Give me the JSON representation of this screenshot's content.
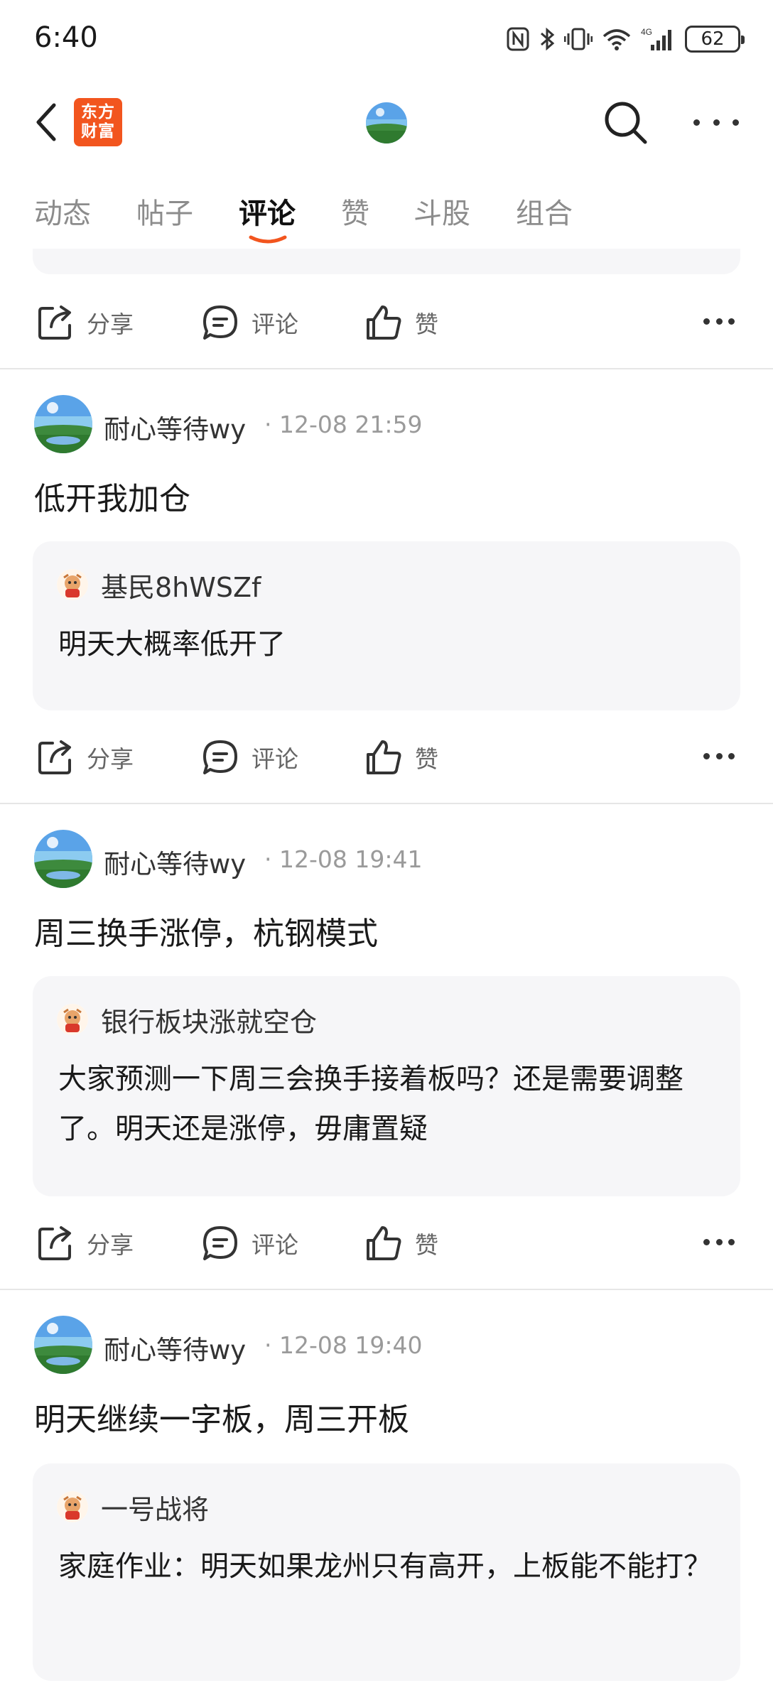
{
  "status_bar": {
    "time": "6:40",
    "battery": "62",
    "network": "4G"
  },
  "nav": {
    "logo_text_line1": "东方",
    "logo_text_line2": "财富",
    "logo_color": "#f2551e"
  },
  "tabs": [
    {
      "label": "动态"
    },
    {
      "label": "帖子"
    },
    {
      "label": "评论",
      "active": true
    },
    {
      "label": "赞"
    },
    {
      "label": "斗股"
    },
    {
      "label": "组合"
    }
  ],
  "actions": {
    "share": "分享",
    "comment": "评论",
    "like": "赞"
  },
  "posts": [
    {
      "author": "耐心等待wy",
      "time": "12-08 21:59",
      "text": "低开我加仓",
      "quote": {
        "author": "基民8hWSZf",
        "text": "明天大概率低开了"
      }
    },
    {
      "author": "耐心等待wy",
      "time": "12-08 19:41",
      "text": "周三换手涨停，杭钢模式",
      "quote": {
        "author": "银行板块涨就空仓",
        "text": "大家预测一下周三会换手接着板吗？还是需要调整了。明天还是涨停，毋庸置疑"
      }
    },
    {
      "author": "耐心等待wy",
      "time": "12-08 19:40",
      "text": "明天继续一字板，周三开板",
      "quote": {
        "author": "一号战将",
        "text": "家庭作业：明天如果龙州只有高开，上板能不能打？"
      }
    }
  ]
}
